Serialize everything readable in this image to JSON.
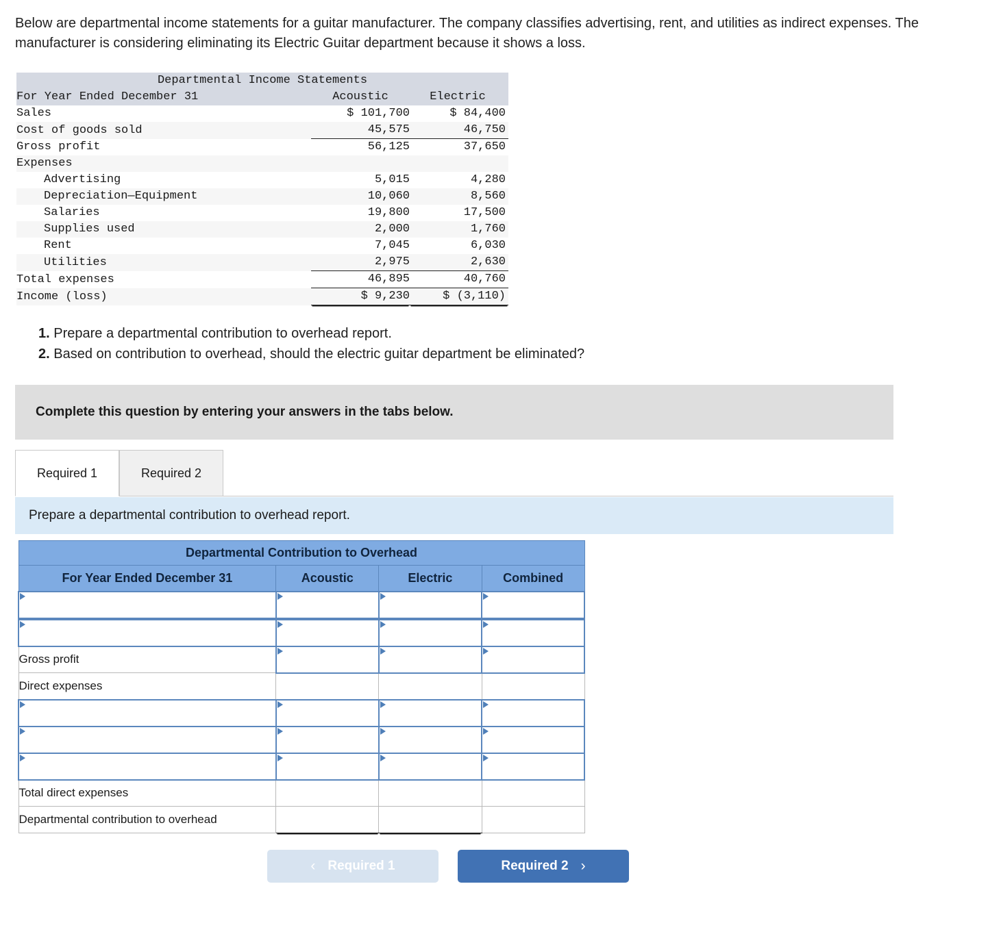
{
  "intro": {
    "paragraph": "Below are departmental income statements for a guitar manufacturer. The company classifies advertising, rent, and utilities as indirect expenses. The manufacturer is considering eliminating its Electric Guitar department because it shows a loss."
  },
  "income_statement": {
    "title": "Departmental Income Statements",
    "period_label": "For Year Ended December 31",
    "col_acoustic": "Acoustic",
    "col_electric": "Electric",
    "rows": [
      {
        "label": "Sales",
        "acoustic": "$ 101,700",
        "electric": "$ 84,400"
      },
      {
        "label": "Cost of goods sold",
        "acoustic": "45,575",
        "electric": "46,750"
      },
      {
        "label": "Gross profit",
        "acoustic": "56,125",
        "electric": "37,650"
      },
      {
        "label": "Expenses",
        "acoustic": "",
        "electric": ""
      },
      {
        "label": "Advertising",
        "acoustic": "5,015",
        "electric": "4,280"
      },
      {
        "label": "Depreciation—Equipment",
        "acoustic": "10,060",
        "electric": "8,560"
      },
      {
        "label": "Salaries",
        "acoustic": "19,800",
        "electric": "17,500"
      },
      {
        "label": "Supplies used",
        "acoustic": "2,000",
        "electric": "1,760"
      },
      {
        "label": "Rent",
        "acoustic": "7,045",
        "electric": "6,030"
      },
      {
        "label": "Utilities",
        "acoustic": "2,975",
        "electric": "2,630"
      },
      {
        "label": "Total expenses",
        "acoustic": "46,895",
        "electric": "40,760"
      },
      {
        "label": "Income (loss)",
        "acoustic": "$ 9,230",
        "electric": "$ (3,110)"
      }
    ]
  },
  "requirements": {
    "item1_num": "1.",
    "item1_text": "Prepare a departmental contribution to overhead report.",
    "item2_num": "2.",
    "item2_text": "Based on contribution to overhead, should the electric guitar department be eliminated?"
  },
  "banner": {
    "text": "Complete this question by entering your answers in the tabs below."
  },
  "tabs": [
    {
      "label": "Required 1",
      "active": true
    },
    {
      "label": "Required 2",
      "active": false
    }
  ],
  "tab_instruction": {
    "text": "Prepare a departmental contribution to overhead report."
  },
  "worksheet": {
    "title": "Departmental Contribution to Overhead",
    "col_period": "For Year Ended December 31",
    "col_acoustic": "Acoustic",
    "col_electric": "Electric",
    "col_combined": "Combined",
    "rows": [
      {
        "label": "",
        "type": "input",
        "cells": "input"
      },
      {
        "label": "",
        "type": "input",
        "cells": "input"
      },
      {
        "label": "Gross profit",
        "type": "static",
        "cells": "input_topline"
      },
      {
        "label": "Direct expenses",
        "type": "static",
        "cells": "blank"
      },
      {
        "label": "",
        "type": "input",
        "cells": "input"
      },
      {
        "label": "",
        "type": "input",
        "cells": "input"
      },
      {
        "label": "",
        "type": "input",
        "cells": "input"
      },
      {
        "label": "Total direct expenses",
        "type": "static",
        "cells": "blank_topline"
      },
      {
        "label": "Departmental contribution to overhead",
        "type": "static",
        "cells": "blank_double"
      }
    ]
  },
  "nav": {
    "prev_label": "Required 1",
    "prev_chevron": "‹",
    "next_label": "Required 2",
    "next_chevron": "›",
    "prev_disabled": true
  },
  "colors": {
    "header_blue": "#7fabe2",
    "button_blue": "#4172b4",
    "button_disabled": "#d7e3f0",
    "banner_gray": "#dedede",
    "instruction_blue": "#daeaf7",
    "statement_header": "#d5d9e2"
  }
}
